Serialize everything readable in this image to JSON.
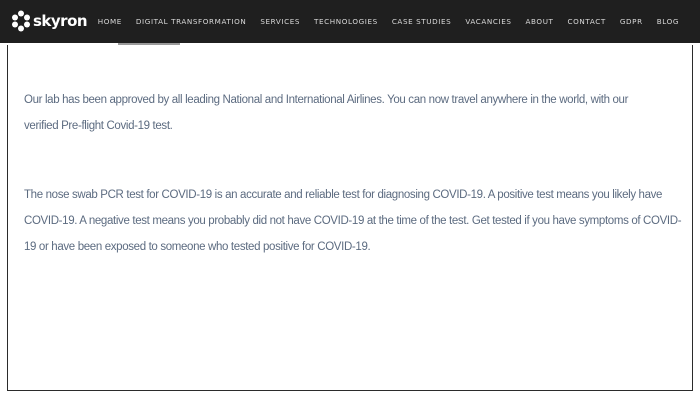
{
  "header": {
    "logo_text": "skyron",
    "logo_icon": "gear-flower-icon",
    "nav": [
      {
        "label": "HOME"
      },
      {
        "label": "DIGITAL TRANSFORMATION"
      },
      {
        "label": "SERVICES"
      },
      {
        "label": "TECHNOLOGIES"
      },
      {
        "label": "CASE STUDIES"
      },
      {
        "label": "VACANCIES"
      },
      {
        "label": "ABOUT"
      },
      {
        "label": "CONTACT"
      },
      {
        "label": "GDPR"
      },
      {
        "label": "BLOG"
      }
    ]
  },
  "main": {
    "paragraph1": "Our lab has been approved by all leading National and International Airlines. You can now travel anywhere in the world, with our verified Pre-flight Covid-19 test.",
    "paragraph2": "The nose swab PCR test for COVID-19 is an accurate and reliable test for diagnosing COVID-19. A positive test means you likely have COVID-19. A negative test means you probably did not have COVID-19 at the time of the test. Get tested if you have symptoms of COVID-19 or have been exposed to someone who tested positive for COVID-19."
  },
  "colors": {
    "header_bg": "#1f1f1f",
    "body_text": "#5c6b80",
    "nav_text": "#d9d9d9"
  }
}
